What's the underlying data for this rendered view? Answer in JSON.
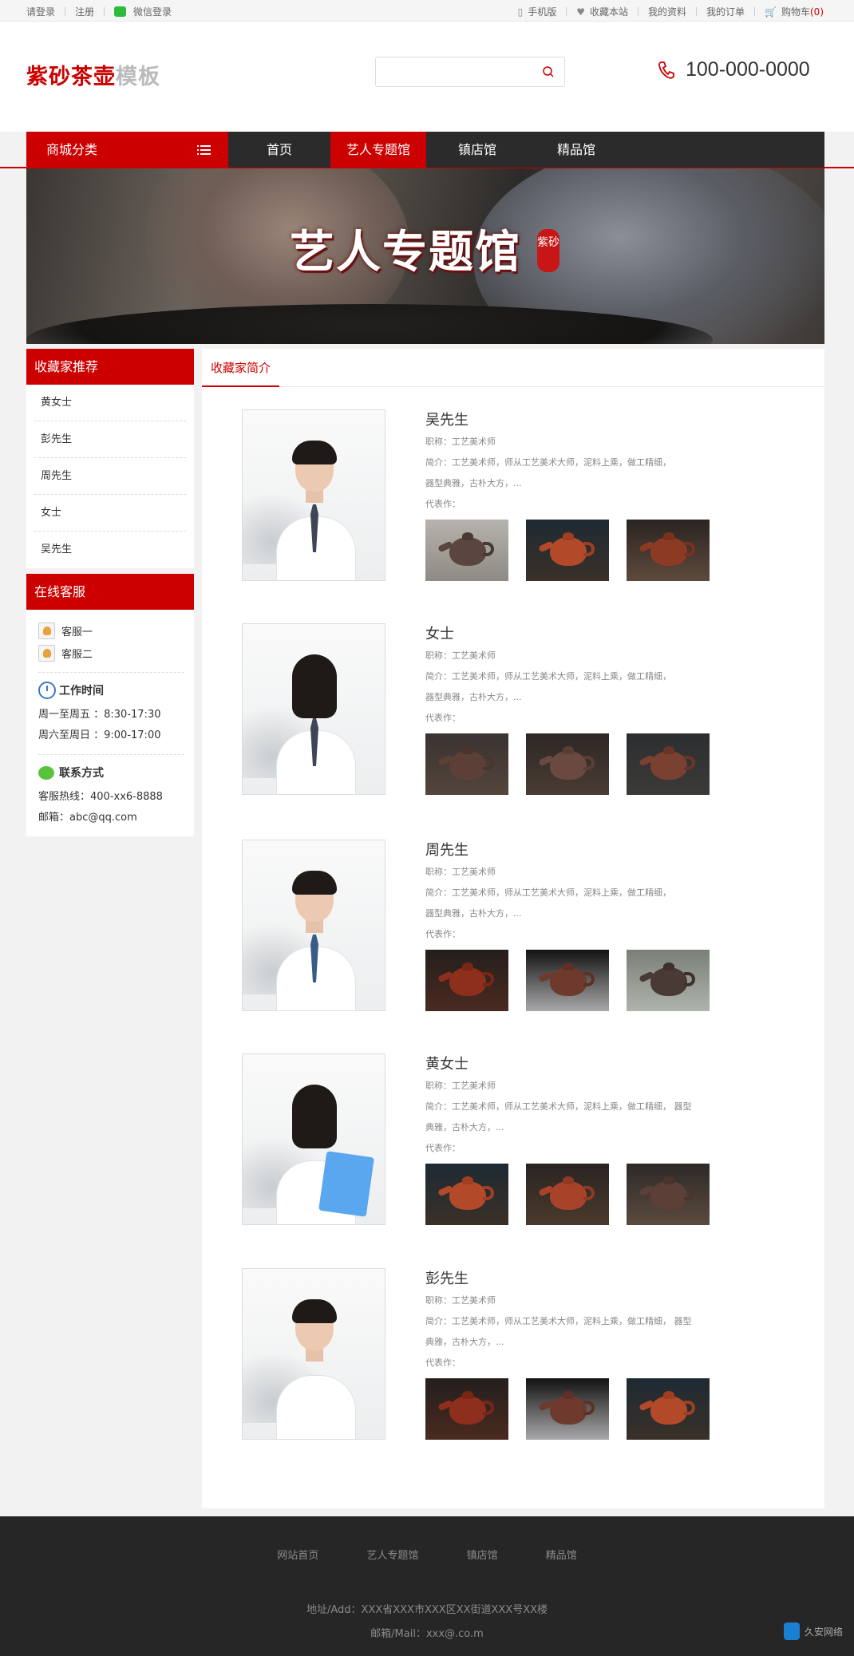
{
  "topbar": {
    "login": "请登录",
    "register": "注册",
    "wechat_login": "微信登录",
    "mobile": "手机版",
    "favorite": "收藏本站",
    "profile": "我的资料",
    "orders": "我的订单",
    "cart": "购物车",
    "cart_count": "(0)"
  },
  "header": {
    "logo_main": "紫砂茶壶",
    "logo_sub": "模板",
    "search_placeholder": "",
    "phone": "100-000-0000"
  },
  "nav": {
    "category": "商城分类",
    "items": [
      "首页",
      "艺人专题馆",
      "镇店馆",
      "精品馆"
    ],
    "active": "艺人专题馆"
  },
  "banner": {
    "title": "艺人专题馆",
    "seal": "紫砂"
  },
  "sidebar": {
    "collectors_title": "收藏家推荐",
    "collectors": [
      "黄女士",
      "彭先生",
      "周先生",
      "女士",
      "吴先生"
    ],
    "service_title": "在线客服",
    "service_agents": [
      "客服一",
      "客服二"
    ],
    "hours_title": "工作时间",
    "hours": [
      "周一至周五 ：8:30-17:30",
      "周六至周日 ：9:00-17:00"
    ],
    "contact_title": "联系方式",
    "contact": [
      "客服热线：400-xx6-8888",
      "邮箱：abc@qq.com"
    ]
  },
  "main": {
    "tab": "收藏家简介",
    "artists": [
      {
        "name": "吴先生",
        "title": "职称：工艺美术师",
        "intro_1": "简介：工艺美术师，师从工艺美术大师，泥料上乘，做工精细，",
        "intro_2": "器型典雅，古朴大方，...",
        "works_label": "代表作："
      },
      {
        "name": "女士",
        "title": "职称：工艺美术师",
        "intro_1": "简介：工艺美术师，师从工艺美术大师，泥料上乘，做工精细，",
        "intro_2": "器型典雅，古朴大方，...",
        "works_label": "代表作："
      },
      {
        "name": "周先生",
        "title": "职称：工艺美术师",
        "intro_1": "简介：工艺美术师，师从工艺美术大师，泥料上乘，做工精细，",
        "intro_2": "器型典雅，古朴大方，...",
        "works_label": "代表作："
      },
      {
        "name": "黄女士",
        "title": "职称：工艺美术师",
        "intro_1": "简介：工艺美术师，师从工艺美术大师，泥料上乘，做工精细， 器型",
        "intro_2": "典雅，古朴大方，...",
        "works_label": "代表作："
      },
      {
        "name": "彭先生",
        "title": "职称：工艺美术师",
        "intro_1": "简介：工艺美术师，师从工艺美术大师，泥料上乘，做工精细， 器型",
        "intro_2": "典雅，古朴大方，...",
        "works_label": "代表作："
      }
    ]
  },
  "footer": {
    "links": [
      "网站首页",
      "艺人专题馆",
      "镇店馆",
      "精品馆"
    ],
    "address": "地址/Add：XXX省XXX市XXX区XX街道XXX号XX楼",
    "email": "邮箱/Mail：xxx@.co.m"
  },
  "watermark": {
    "text": "久安网络"
  },
  "colors": {
    "accent": "#cc0000",
    "nav_bg": "#2b2b2b",
    "footer_bg": "#262626"
  }
}
